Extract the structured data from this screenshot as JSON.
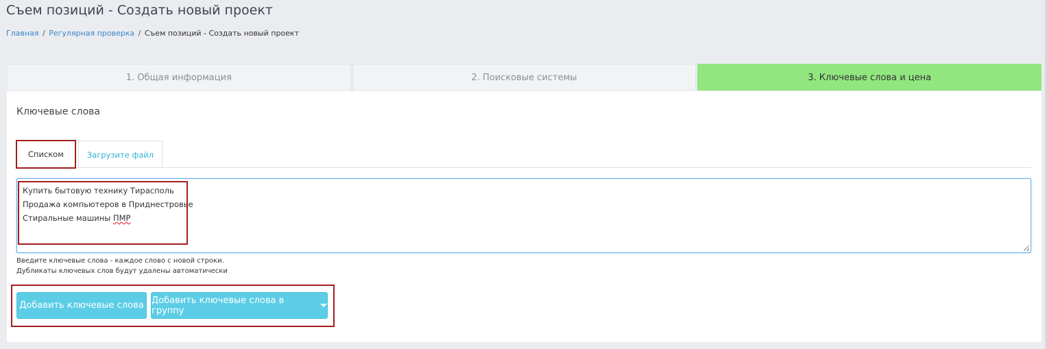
{
  "page_title": "Съем позиций - Создать новый проект",
  "breadcrumb": {
    "items": [
      "Главная",
      "Регулярная проверка"
    ],
    "separator": "/",
    "current": "Съем позиций - Создать новый проект"
  },
  "steps": [
    {
      "label": "1. Общая информация",
      "active": false
    },
    {
      "label": "2. Поисковые системы",
      "active": false
    },
    {
      "label": "3. Ключевые слова и цена",
      "active": true
    }
  ],
  "section": {
    "title": "Ключевые слова"
  },
  "tabs": [
    {
      "label": "Списком",
      "active": true
    },
    {
      "label": "Загрузите файл",
      "active": false
    }
  ],
  "keywords": {
    "lines": [
      "Купить бытовую технику Тирасполь",
      "Продажа компьютеров в Приднестровье",
      "Стиральные машины ",
      "ПМР"
    ]
  },
  "hints": [
    "Введите ключевые слова - каждое слово с новой строки.",
    "Дубликаты ключевых слов будут удалены автоматически"
  ],
  "buttons": {
    "add": "Добавить ключевые слова",
    "add_group": "Добавить ключевые слова в группу"
  },
  "colors": {
    "active_step": "#92e67f",
    "button": "#5bcde6",
    "highlight": "#a11c1c",
    "link": "#3a85c7"
  }
}
